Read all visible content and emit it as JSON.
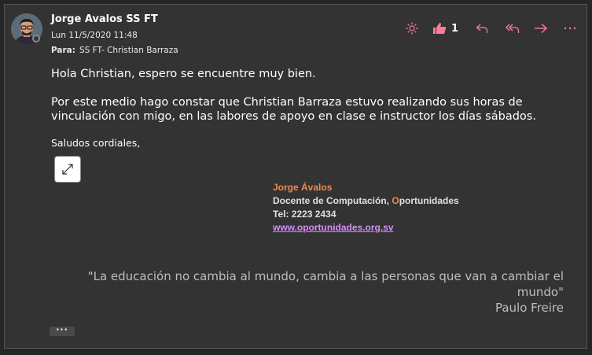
{
  "message": {
    "sender_name": "Jorge Avalos SS FT",
    "date": "Lun 11/5/2020 11:48",
    "to_label": "Para:",
    "to_value": "SS FT- Christian Barraza",
    "greeting": "Hola Christian, espero se encuentre muy bien.",
    "paragraph_line1": "Por este medio hago constar que Christian Barraza estuvo realizando sus horas de",
    "paragraph_line2": "vinculación con migo, en las labores de apoyo en clase e instructor los días sábados.",
    "closing": "Saludos cordiales,"
  },
  "actions": {
    "like_count": "1",
    "icons": [
      "sun-icon",
      "thumbs-up-icon",
      "reply-icon",
      "reply-all-icon",
      "forward-icon",
      "more-options-icon"
    ]
  },
  "signature": {
    "name": "Jorge Ávalos",
    "title_before_accent": "Docente de Computación, ",
    "title_accent": "O",
    "title_after_accent": "portunidades",
    "tel": "Tel: 2223 2434",
    "website": "www.oportunidades.org.sv"
  },
  "quote": {
    "text": "\"La educación no cambia al mundo, cambia a las personas que van a cambiar el mundo\"",
    "author": "Paulo Freire"
  },
  "more_button_label": "···",
  "colors": {
    "background": "#262626",
    "card": "#333333",
    "accent_pink": "#ff7a9a",
    "signature_orange": "#f08a4b",
    "link_purple": "#d98bff"
  }
}
